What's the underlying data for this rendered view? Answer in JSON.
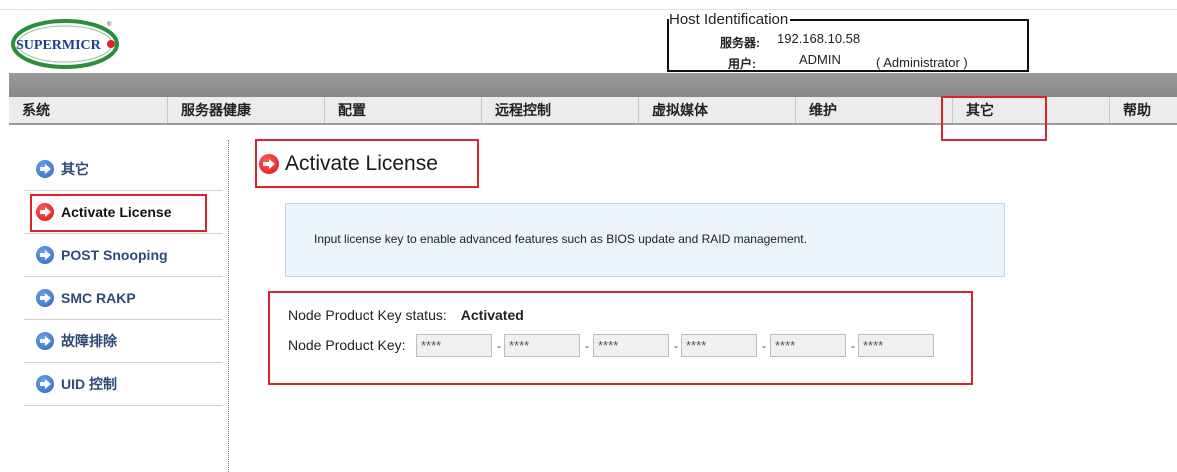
{
  "brand": {
    "logo_text": "SUPERMICRO"
  },
  "host": {
    "legend": "Host Identification",
    "server_label": "服务器:",
    "server_value": "192.168.10.58",
    "user_label": "用户:",
    "user_value": "ADMIN",
    "user_role": "( Administrator )"
  },
  "nav": {
    "items": [
      {
        "label": "系统"
      },
      {
        "label": "服务器健康"
      },
      {
        "label": "配置"
      },
      {
        "label": "远程控制"
      },
      {
        "label": "虚拟媒体"
      },
      {
        "label": "维护"
      },
      {
        "label": "其它"
      },
      {
        "label": "帮助"
      }
    ],
    "active_index": 6
  },
  "sidebar": {
    "items": [
      {
        "label": "其它",
        "icon": "blue-arrow-icon"
      },
      {
        "label": "Activate License",
        "icon": "red-arrow-icon"
      },
      {
        "label": "POST Snooping",
        "icon": "blue-arrow-icon"
      },
      {
        "label": "SMC RAKP",
        "icon": "blue-arrow-icon"
      },
      {
        "label": "故障排除",
        "icon": "blue-arrow-icon"
      },
      {
        "label": "UID 控制",
        "icon": "blue-arrow-icon"
      }
    ],
    "active_index": 1
  },
  "page": {
    "title": "Activate License",
    "info": "Input license key to enable advanced features such as BIOS update and RAID management.",
    "status_label": "Node Product Key status:",
    "status_value": "Activated",
    "key_label": "Node Product Key:",
    "key_fields": [
      "****",
      "****",
      "****",
      "****",
      "****",
      "****"
    ],
    "separator": "-"
  },
  "colors": {
    "highlight": "#d9232e",
    "link": "#2e4a75",
    "band": "#8f8f8f",
    "info_bg": "#eef4fb"
  }
}
